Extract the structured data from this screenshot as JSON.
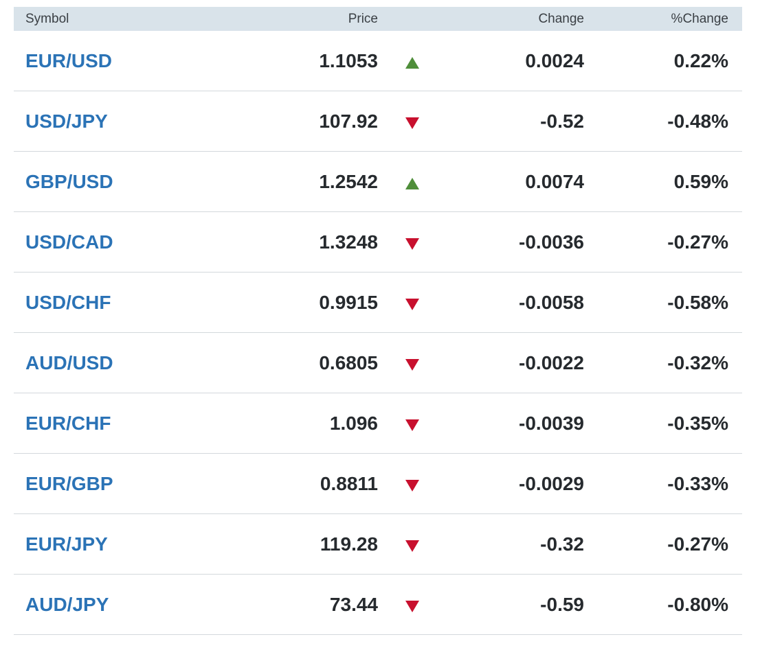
{
  "header": {
    "symbol": "Symbol",
    "price": "Price",
    "change": "Change",
    "pct_change": "%Change"
  },
  "colors": {
    "link": "#2b73b6",
    "up": "#4f8e3a",
    "down": "#c8102e",
    "header_bg": "#d9e3ea"
  },
  "rows": [
    {
      "symbol": "EUR/USD",
      "price": "1.1053",
      "direction": "up",
      "change": "0.0024",
      "pct": "0.22%"
    },
    {
      "symbol": "USD/JPY",
      "price": "107.92",
      "direction": "down",
      "change": "-0.52",
      "pct": "-0.48%"
    },
    {
      "symbol": "GBP/USD",
      "price": "1.2542",
      "direction": "up",
      "change": "0.0074",
      "pct": "0.59%"
    },
    {
      "symbol": "USD/CAD",
      "price": "1.3248",
      "direction": "down",
      "change": "-0.0036",
      "pct": "-0.27%"
    },
    {
      "symbol": "USD/CHF",
      "price": "0.9915",
      "direction": "down",
      "change": "-0.0058",
      "pct": "-0.58%"
    },
    {
      "symbol": "AUD/USD",
      "price": "0.6805",
      "direction": "down",
      "change": "-0.0022",
      "pct": "-0.32%"
    },
    {
      "symbol": "EUR/CHF",
      "price": "1.096",
      "direction": "down",
      "change": "-0.0039",
      "pct": "-0.35%"
    },
    {
      "symbol": "EUR/GBP",
      "price": "0.8811",
      "direction": "down",
      "change": "-0.0029",
      "pct": "-0.33%"
    },
    {
      "symbol": "EUR/JPY",
      "price": "119.28",
      "direction": "down",
      "change": "-0.32",
      "pct": "-0.27%"
    },
    {
      "symbol": "AUD/JPY",
      "price": "73.44",
      "direction": "down",
      "change": "-0.59",
      "pct": "-0.80%"
    }
  ]
}
